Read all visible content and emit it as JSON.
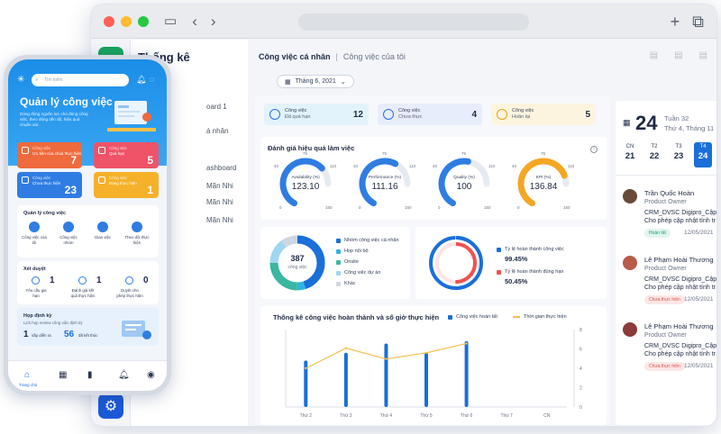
{
  "colors": {
    "primary": "#1a6fd9",
    "green": "#19a35b",
    "orange": "#f5a623",
    "red": "#ef5350",
    "teal": "#3ab7a0"
  },
  "browser": {
    "sidebar_title": "Thống kê",
    "sidebar_items": [
      "oard 1",
      "á nhân",
      "ashboard",
      "Mãn Nhi",
      "Mãn Nhi",
      "Mãn Nhi"
    ]
  },
  "header": {
    "tab_personal": "Công việc cá nhân",
    "tab_mine": "Công việc của tôi",
    "date_select": "Tháng 6, 2021"
  },
  "stats": [
    {
      "label1": "Công việc",
      "label2": "Đã quá hạn",
      "value": "12",
      "bg": "#e3f3fb"
    },
    {
      "label1": "Công việc",
      "label2": "Chưa thực",
      "value": "4",
      "bg": "#e8edfb"
    },
    {
      "label1": "Công việc",
      "label2": "Hoãn lại",
      "value": "5",
      "bg": "#fdf4df"
    }
  ],
  "gauges": {
    "title": "Đánh giá hiệu quả làm việc",
    "items": [
      {
        "name": "Availability (%)",
        "value": "123.10",
        "min": "0",
        "max": "150",
        "t1": "40",
        "t2": "75",
        "t3": "110",
        "color": "#2f7de3"
      },
      {
        "name": "Performance (%)",
        "value": "111.16",
        "min": "0",
        "max": "150",
        "t1": "40",
        "t2": "75",
        "t3": "110",
        "color": "#2f7de3"
      },
      {
        "name": "Quality (%)",
        "value": "100",
        "min": "0",
        "max": "150",
        "t1": "40",
        "t2": "75",
        "t3": "110",
        "color": "#2f7de3"
      },
      {
        "name": "KPI (%)",
        "value": "136.84",
        "min": "0",
        "max": "150",
        "t1": "40",
        "t2": "75",
        "t3": "110",
        "color": "#f5a623"
      }
    ]
  },
  "donut": {
    "center_value": "387",
    "center_label": "công việc",
    "legend": [
      {
        "label": "Nhóm công việc cá nhân",
        "color": "#1a6fd9"
      },
      {
        "label": "Họp nội bộ",
        "color": "#2fb5e0"
      },
      {
        "label": "Onsite",
        "color": "#3ab7a0"
      },
      {
        "label": "Công việc dự án",
        "color": "#9fd6f0"
      },
      {
        "label": "Khác",
        "color": "#cfd6e3"
      }
    ]
  },
  "rings": {
    "items": [
      {
        "label": "Tỷ lệ hoàn thành công việc",
        "value": "99.45%",
        "color": "#1a6fd9"
      },
      {
        "label": "Tỷ lệ hoàn thành đúng hạn",
        "value": "50.45%",
        "color": "#ef5350"
      }
    ]
  },
  "chart_data": {
    "type": "bar",
    "title": "Thống kê công việc hoàn thành và số giờ thực hiện",
    "categories": [
      "Thứ 2",
      "Thứ 3",
      "Thứ 4",
      "Thứ 5",
      "Thứ 6",
      "Thứ 7",
      "CN"
    ],
    "series": [
      {
        "name": "Công việc hoàn tất",
        "type": "bar",
        "color": "#1a6fd9",
        "values": [
          6,
          7,
          8.2,
          7,
          8.5,
          0,
          0
        ]
      },
      {
        "name": "Thời gian thực hiện",
        "type": "line",
        "color": "#f5c04a",
        "values": [
          5,
          7.6,
          6.2,
          7,
          8.2,
          null,
          null
        ]
      }
    ],
    "yticks_right": [
      "8",
      "6",
      "4",
      "2",
      "0"
    ],
    "ylim": [
      0,
      10
    ]
  },
  "calendar": {
    "day": "24",
    "week": "Tuần 32",
    "weekday": "Thứ 4, Tháng 11",
    "days": [
      {
        "w": "CN",
        "d": "21"
      },
      {
        "w": "T2",
        "d": "22"
      },
      {
        "w": "T3",
        "d": "23"
      },
      {
        "w": "T4",
        "d": "24"
      }
    ]
  },
  "people": [
    {
      "name": "Trần Quốc Hoàn",
      "role": "Product Owner",
      "desc1": "CRM_DVSC Digipro_Cập",
      "desc2": "Cho phép cập nhật tính tr",
      "badge": "Hoàn tất",
      "badge_bg": "#dff6ee",
      "badge_fg": "#1b9c73",
      "date": "12/05/2021"
    },
    {
      "name": "Lê Phạm Hoài Thương",
      "role": "Product Owner",
      "desc1": "CRM_DVSC Digipro_Cập",
      "desc2": "Cho phép cập nhật tính tr",
      "badge": "Chưa thực hiện",
      "badge_bg": "#fde6e6",
      "badge_fg": "#d9534f",
      "date": "12/05/2021"
    },
    {
      "name": "Lê Phạm Hoài Thương",
      "role": "Product Owner",
      "desc1": "CRM_DVSC Digipro_Cập",
      "desc2": "Cho phép cập nhật tính tr",
      "badge": "Chưa thực hiện",
      "badge_bg": "#fde6e6",
      "badge_fg": "#d9534f",
      "date": "12/05/2021"
    }
  ],
  "phone": {
    "search_placeholder": "Tìm kiếm",
    "title": "Quản lý công việc",
    "subtitle": "Dùng đúng nguồn lực cho đúng công việc, theo đúng tiến độ, hiệu quả chuẩn xác",
    "tiles": [
      {
        "l1": "Công việc",
        "l2": "Ưu tiên của chúa thực hiện",
        "n": "7",
        "bg": "#ef6a3c"
      },
      {
        "l1": "Công việc",
        "l2": "Quá hạn",
        "n": "5",
        "bg": "#ef5368"
      },
      {
        "l1": "Công việc",
        "l2": "Chưa thực hiện",
        "n": "23",
        "bg": "#2f7de3"
      },
      {
        "l1": "Công việc",
        "l2": "Đang thực hiện",
        "n": "1",
        "bg": "#f5b12a"
      }
    ],
    "quan_ly_title": "Quản lý công việc",
    "quan_ly_items": [
      "Công việc của tôi",
      "Công việc nhóm",
      "Giao việc",
      "Theo dõi thực hiện"
    ],
    "xet_duyet_title": "Xét duyệt",
    "xet_duyet_items": [
      {
        "label": "Yêu cầu gia hạn",
        "n": "1"
      },
      {
        "label": "Đánh giá kết quả thực hiện",
        "n": "1"
      },
      {
        "label": "Duyệt cho phép thực hiện",
        "n": "0"
      }
    ],
    "hop_title": "Họp định kỳ",
    "hop_sub": "Lịch họp review công việc định kỳ",
    "hop_n1": "1",
    "hop_l1": "sắp diễn ra",
    "hop_n2": "56",
    "hop_l2": "đã kết thúc",
    "tab_home": "Trang chủ"
  }
}
